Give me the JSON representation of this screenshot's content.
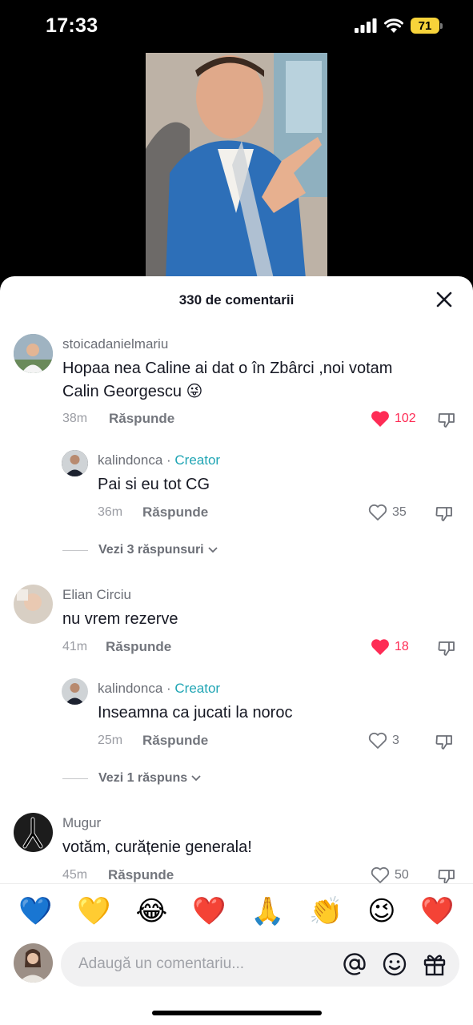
{
  "status": {
    "time": "17:33",
    "battery": "71"
  },
  "sheet": {
    "title": "330 de comentarii"
  },
  "comments": [
    {
      "user": "stoicadanielmariu",
      "text": "Hopaa nea Caline ai dat o în Zbârci ,noi votam Calin Georgescu 😜",
      "time": "38m",
      "reply": "Răspunde",
      "likes": "102",
      "liked": true
    },
    {
      "user": "kalindonca",
      "sep": " · ",
      "badge": "Creator",
      "text": "Pai si eu tot CG",
      "time": "36m",
      "reply": "Răspunde",
      "likes": "35",
      "liked": false
    },
    {
      "view_replies": "Vezi 3 răspunsuri"
    },
    {
      "user": "Elian Circiu",
      "text": "nu vrem rezerve",
      "time": "41m",
      "reply": "Răspunde",
      "likes": "18",
      "liked": true
    },
    {
      "user": "kalindonca",
      "sep": " · ",
      "badge": "Creator",
      "text": "Inseamna ca jucati la noroc",
      "time": "25m",
      "reply": "Răspunde",
      "likes": "3",
      "liked": false
    },
    {
      "view_replies": "Vezi 1 răspuns"
    },
    {
      "user": "Mugur",
      "text": "votăm, curățenie generala!",
      "time": "45m",
      "reply": "Răspunde",
      "likes": "50",
      "liked": false
    }
  ],
  "emojis": [
    "💙",
    "💛",
    "😂",
    "❤️",
    "🙏",
    "👏",
    "😉",
    "❤️"
  ],
  "input": {
    "placeholder": "Adaugă un comentariu..."
  },
  "colors": {
    "accent": "#fe2c55",
    "creator": "#20a5b4"
  }
}
